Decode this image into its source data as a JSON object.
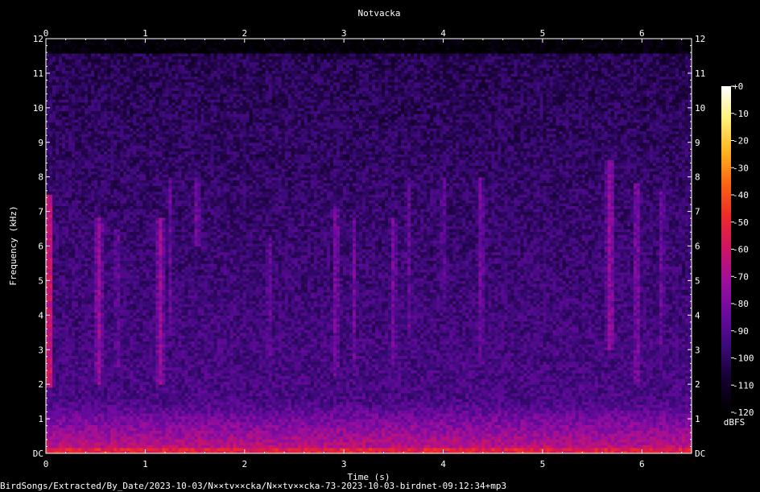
{
  "chart_data": {
    "type": "heatmap",
    "title": "Notvacka",
    "xlabel": "Time (s)",
    "ylabel": "Frequency (kHz)",
    "xlim": [
      0,
      6.5
    ],
    "ylim": [
      0,
      12
    ],
    "x_ticks": [
      "0",
      "1",
      "2",
      "3",
      "4",
      "5",
      "6"
    ],
    "y_ticks": [
      "DC",
      "1",
      "2",
      "3",
      "4",
      "5",
      "6",
      "7",
      "8",
      "9",
      "10",
      "11",
      "12"
    ],
    "colorbar": {
      "label": "dBFS",
      "range": [
        -120,
        0
      ],
      "ticks": [
        "+0",
        "-10",
        "-20",
        "-30",
        "-40",
        "-50",
        "-60",
        "-70",
        "-80",
        "-90",
        "-100",
        "-110",
        "-120"
      ],
      "colormap": [
        "#000000",
        "#14002e",
        "#3a0a78",
        "#6a0aa0",
        "#9c0f9c",
        "#cc1466",
        "#ee2a2a",
        "#fa6414",
        "#ffb41e",
        "#fff078",
        "#ffffff"
      ]
    },
    "calls": [
      {
        "t": 0.03,
        "f_low": 1.9,
        "f_high": 7.5,
        "level": -55
      },
      {
        "t": 0.53,
        "f_low": 2.0,
        "f_high": 6.8,
        "level": -72
      },
      {
        "t": 0.72,
        "f_low": 2.5,
        "f_high": 6.5,
        "level": -82
      },
      {
        "t": 1.15,
        "f_low": 2.0,
        "f_high": 6.8,
        "level": -72
      },
      {
        "t": 1.25,
        "f_low": 3.5,
        "f_high": 8.0,
        "level": -84
      },
      {
        "t": 1.52,
        "f_low": 6.0,
        "f_high": 8.0,
        "level": -80
      },
      {
        "t": 2.25,
        "f_low": 2.8,
        "f_high": 6.3,
        "level": -82
      },
      {
        "t": 2.92,
        "f_low": 2.2,
        "f_high": 7.2,
        "level": -78
      },
      {
        "t": 3.1,
        "f_low": 2.5,
        "f_high": 6.8,
        "level": -82
      },
      {
        "t": 3.5,
        "f_low": 2.5,
        "f_high": 6.8,
        "level": -80
      },
      {
        "t": 3.65,
        "f_low": 3.5,
        "f_high": 8.0,
        "level": -84
      },
      {
        "t": 4.0,
        "f_low": 4.5,
        "f_high": 8.0,
        "level": -84
      },
      {
        "t": 4.38,
        "f_low": 2.5,
        "f_high": 8.0,
        "level": -80
      },
      {
        "t": 5.68,
        "f_low": 3.0,
        "f_high": 8.5,
        "level": -72
      },
      {
        "t": 5.95,
        "f_low": 2.0,
        "f_high": 7.8,
        "level": -76
      },
      {
        "t": 6.2,
        "f_low": 2.5,
        "f_high": 7.6,
        "level": -82
      }
    ],
    "noise_floor": {
      "below_1khz": -65,
      "mid_band": -92,
      "above_11_5khz": -120
    }
  },
  "footer_path": "BirdSongs/Extracted/By_Date/2023-10-03/N××tv××cka/N××tv××cka-73-2023-10-03-birdnet-09:12:34+mp3"
}
